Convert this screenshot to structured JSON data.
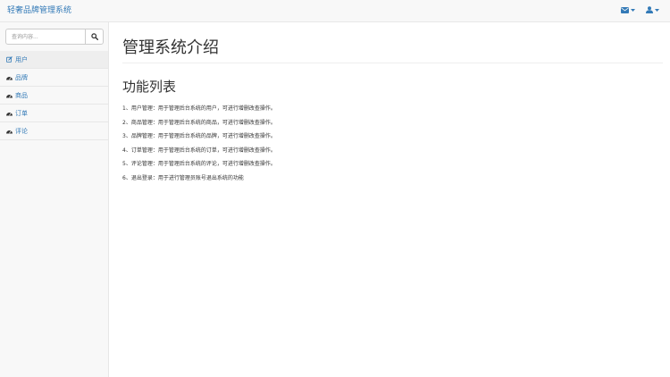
{
  "header": {
    "brand": "轻奢品牌管理系统",
    "icons": [
      "envelope-icon",
      "user-icon"
    ]
  },
  "sidebar": {
    "search": {
      "placeholder": "查询内容...",
      "value": ""
    },
    "items": [
      {
        "icon": "edit-icon",
        "label": "用户"
      },
      {
        "icon": "dashboard-icon",
        "label": "品牌"
      },
      {
        "icon": "dashboard-icon",
        "label": "商品"
      },
      {
        "icon": "dashboard-icon",
        "label": "订单"
      },
      {
        "icon": "dashboard-icon",
        "label": "评论"
      }
    ]
  },
  "main": {
    "title": "管理系统介绍",
    "section_title": "功能列表",
    "features": [
      "1、用户管理：用于管理后台系统的用户，可进行增删改查操作。",
      "2、商品管理：用于管理后台系统的商品，可进行增删改查操作。",
      "3、品牌管理：用于管理后台系统的品牌，可进行增删改查操作。",
      "4、订单管理：用于管理后台系统的订单，可进行增删改查操作。",
      "5、评论管理：用于管理后台系统的评论，可进行增删改查操作。",
      "6、退出登录：用于进行管理员账号退出系统的功能"
    ]
  },
  "colors": {
    "link": "#337ab7",
    "navbar_bg": "#f8f8f8",
    "active_item_bg": "#eeeeee",
    "border": "#e7e7e7"
  }
}
